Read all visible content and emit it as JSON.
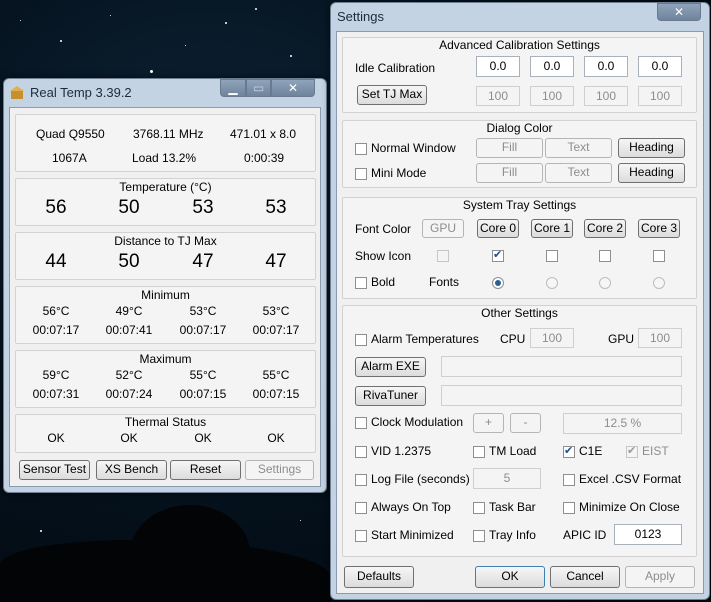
{
  "realtemp": {
    "title": "Real Temp 3.39.2",
    "cpu_name": "Quad Q9550",
    "freq": "3768.11 MHz",
    "multiplier": "471.01 x 8.0",
    "vid": "1067A",
    "load": "Load  13.2%",
    "time": "0:00:39",
    "temperature": {
      "title": "Temperature (°C)",
      "values": [
        "56",
        "50",
        "53",
        "53"
      ]
    },
    "distance": {
      "title": "Distance to TJ Max",
      "values": [
        "44",
        "50",
        "47",
        "47"
      ]
    },
    "minimum": {
      "title": "Minimum",
      "temps": [
        "56°C",
        "49°C",
        "53°C",
        "53°C"
      ],
      "times": [
        "00:07:17",
        "00:07:41",
        "00:07:17",
        "00:07:17"
      ]
    },
    "maximum": {
      "title": "Maximum",
      "temps": [
        "59°C",
        "52°C",
        "55°C",
        "55°C"
      ],
      "times": [
        "00:07:31",
        "00:07:24",
        "00:07:15",
        "00:07:15"
      ]
    },
    "thermal": {
      "title": "Thermal Status",
      "values": [
        "OK",
        "OK",
        "OK",
        "OK"
      ]
    },
    "buttons": {
      "sensor": "Sensor Test",
      "xs": "XS Bench",
      "reset": "Reset",
      "settings": "Settings"
    }
  },
  "settings": {
    "title": "Settings",
    "calib": {
      "title": "Advanced Calibration Settings",
      "idle_label": "Idle Calibration",
      "idle_values": [
        "0.0",
        "0.0",
        "0.0",
        "0.0"
      ],
      "set_tj": "Set TJ Max",
      "tj_values": [
        "100",
        "100",
        "100",
        "100"
      ]
    },
    "dialog": {
      "title": "Dialog Color",
      "normal": "Normal Window",
      "mini": "Mini Mode",
      "fill": "Fill",
      "text": "Text",
      "heading": "Heading"
    },
    "tray": {
      "title": "System Tray Settings",
      "font_color": "Font Color",
      "cores": [
        "GPU",
        "Core 0",
        "Core 1",
        "Core 2",
        "Core 3"
      ],
      "show_icon": "Show Icon",
      "bold": "Bold",
      "fonts": "Fonts"
    },
    "other": {
      "title": "Other Settings",
      "alarm_temps": "Alarm Temperatures",
      "cpu_label": "CPU",
      "cpu_value": "100",
      "gpu_label": "GPU",
      "gpu_value": "100",
      "alarm_exe": "Alarm EXE",
      "rivatuner": "RivaTuner",
      "clock_mod": "Clock Modulation",
      "plus": "+",
      "minus": "-",
      "clock_value": "12.5 %",
      "vid": "VID   1.2375",
      "tm_load": "TM Load",
      "c1e": "C1E",
      "eist": "EIST",
      "log_file": "Log File (seconds)",
      "log_value": "5",
      "excel": "Excel .CSV Format",
      "always_top": "Always On Top",
      "task_bar": "Task Bar",
      "min_close": "Minimize On Close",
      "start_min": "Start Minimized",
      "tray_info": "Tray Info",
      "apic_label": "APIC ID",
      "apic_value": "0123"
    },
    "buttons": {
      "defaults": "Defaults",
      "ok": "OK",
      "cancel": "Cancel",
      "apply": "Apply"
    }
  }
}
